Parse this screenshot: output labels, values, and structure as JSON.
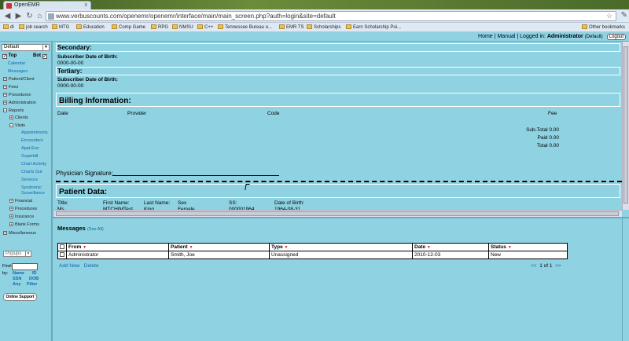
{
  "browser": {
    "tab_title": "OpenEMR",
    "tab_close": "x",
    "url": "www.verbuscounts.com/openemr/openemr/interface/main/main_screen.php?auth=login&site=default",
    "bookmarks": [
      "dl",
      "job search",
      "MTG",
      "Education",
      "Comp Game",
      "RPG",
      "NMSU",
      "C++",
      "Tennessee Bureau o...",
      "EMR TS",
      "Scholarships",
      "Earn Scholarship Poi..."
    ],
    "other_bookmarks": "Other bookmarks"
  },
  "topnav": {
    "home": "Home",
    "sep1": "|",
    "manual": "Manual",
    "sep2": "|",
    "logged_in": "Logged in:",
    "user": "Administrator",
    "site": "(Default)",
    "logout": "Logout"
  },
  "sidebar": {
    "select_value": "Default",
    "top_label": "Top",
    "bot_label": "Bot",
    "items": {
      "calendar": "Calendar",
      "messages": "Messages",
      "patient_client": "Patient/Client",
      "fees": "Fees",
      "procedures": "Procedures",
      "administration": "Administration",
      "reports": "Reports",
      "clients": "Clients",
      "visits": "Visits",
      "appointments": "Appointments",
      "encounters": "Encounters",
      "appt_enc": "Appt-Enc",
      "superbill": "Superbill",
      "chart_activity": "Chart Activity",
      "charts_out": "Charts Out",
      "services": "Services",
      "syndromic_1": "Syndromic",
      "syndromic_2": "Surveillance",
      "financial": "Financial",
      "procedures2": "Procedures",
      "insurance": "Insurance",
      "blank_forms": "Blank Forms",
      "miscellaneous": "Miscellaneous"
    },
    "popups": "Popups",
    "find_label": "Find:",
    "by_label": "by:",
    "find_opts": {
      "name": "Name",
      "id": "ID",
      "ssn": "SSN",
      "dob": "DOB",
      "any": "Any",
      "filter": "Filter"
    },
    "support": "Online Support"
  },
  "encounter": {
    "secondary": "Secondary:",
    "tertiary": "Tertiary:",
    "sub_dob_label": "Subscriber Date of Birth:",
    "sub_dob_value": "0000-00-00",
    "billing_title": "Billing Information:",
    "cols": {
      "date": "Date",
      "provider": "Provider",
      "code": "Code",
      "fee": "Fee"
    },
    "subtotal": "Sub-Total 0.00",
    "paid": "Paid 0.00",
    "total": "Total 0.00",
    "signature": "Physician Signature:",
    "patient_data_title": "Patient Data:",
    "patient": {
      "title_label": "Title:",
      "title_value": "Ms.",
      "first_label": "First Name:",
      "first_value": "MTCHIMTest",
      "last_label": "Last Name:",
      "last_value": "King",
      "sex_label": "Sex",
      "sex_value": "Female",
      "ss_label": "SS:",
      "ss_value": "000001964",
      "dob_label": "Date of Birth:",
      "dob_value": "1964-08-31"
    }
  },
  "messages": {
    "heading": "Messages",
    "see_all": "(See All)",
    "columns": [
      "From",
      "Patient",
      "Type",
      "Date",
      "Status"
    ],
    "rows": [
      {
        "from": "Administrator",
        "patient": "Smith, Joe",
        "type": "Unassigned",
        "date": "2010-12-03",
        "status": "New"
      }
    ],
    "add_new": "Add New",
    "delete": "Delete",
    "pager": {
      "prev": "<<",
      "text": "1 of 1",
      "next": ">>"
    }
  }
}
